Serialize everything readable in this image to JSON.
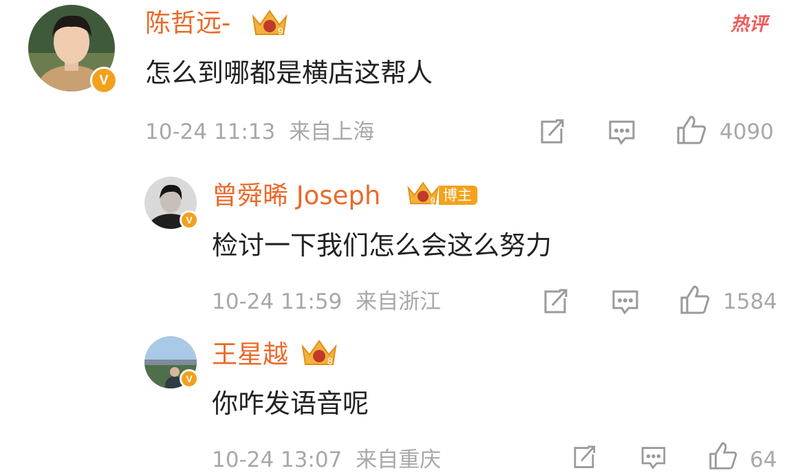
{
  "hot_label": "热评",
  "comments": [
    {
      "user": "陈哲远-",
      "level": "9",
      "text": "怎么到哪都是横店这帮人",
      "date": "10-24 11:13",
      "location": "来自上海",
      "likes": "4090"
    },
    {
      "user": "曾舜晞 Joseph",
      "level": "9",
      "badge": "博主",
      "text": "检讨一下我们怎么会这么努力",
      "date": "10-24 11:59",
      "location": "来自浙江",
      "likes": "1584"
    },
    {
      "user": "王星越",
      "level": "8",
      "text": "你咋发语音呢",
      "date": "10-24 13:07",
      "location": "来自重庆",
      "likes": "64"
    }
  ],
  "verified_mark": "V",
  "icons": [
    "share-icon",
    "comment-icon",
    "like-icon",
    "crown-badge-icon"
  ],
  "colors": {
    "name": "#ea6a2b",
    "meta": "#a8a8a8",
    "hot": "#f05a5a",
    "badge": "#f4a21c"
  }
}
